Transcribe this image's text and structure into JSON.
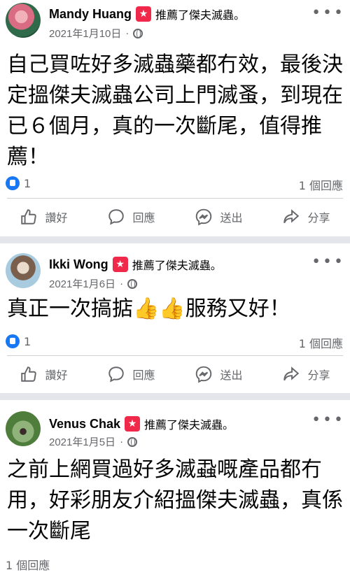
{
  "colors": {
    "background": "#e4e6eb",
    "card": "#ffffff",
    "secondary_text": "#65676b",
    "like_blue": "#1877f2",
    "recommend_red": "#f02849"
  },
  "posts": [
    {
      "author": "Mandy Huang",
      "action": "推薦了傑夫滅蟲。",
      "date": "2021年1月10日",
      "dot": "·",
      "text": "自己買咗好多滅蟲藥都冇效，最後決定搵傑夫滅蟲公司上門滅蚤，到現在已６個月，真的一次斷尾，值得推薦！",
      "reaction_count": "1",
      "comment_count": "1 個回應",
      "actions": [
        "讚好",
        "回應",
        "送出",
        "分享"
      ]
    },
    {
      "author": "Ikki Wong",
      "action": "推薦了傑夫滅蟲。",
      "date": "2021年1月6日",
      "dot": "·",
      "text": "真正一次搞掂👍👍服務又好！",
      "reaction_count": "1",
      "comment_count": "1 個回應",
      "actions": [
        "讚好",
        "回應",
        "送出",
        "分享"
      ]
    },
    {
      "author": "Venus Chak",
      "action": "推薦了傑夫滅蟲。",
      "date": "2021年1月5日",
      "dot": "·",
      "text": "之前上網買過好多滅蝨嘅產品都冇用，好彩朋友介紹搵傑夫滅蟲，真係一次斷尾",
      "comment_count": "1 個回應"
    }
  ],
  "icons": {
    "recommend": "star-badge-icon",
    "privacy": "globe-icon",
    "more": "more-dots-icon",
    "like": "thumbs-up-icon",
    "comment": "comment-bubble-icon",
    "send": "messenger-icon",
    "share": "share-arrow-icon"
  }
}
